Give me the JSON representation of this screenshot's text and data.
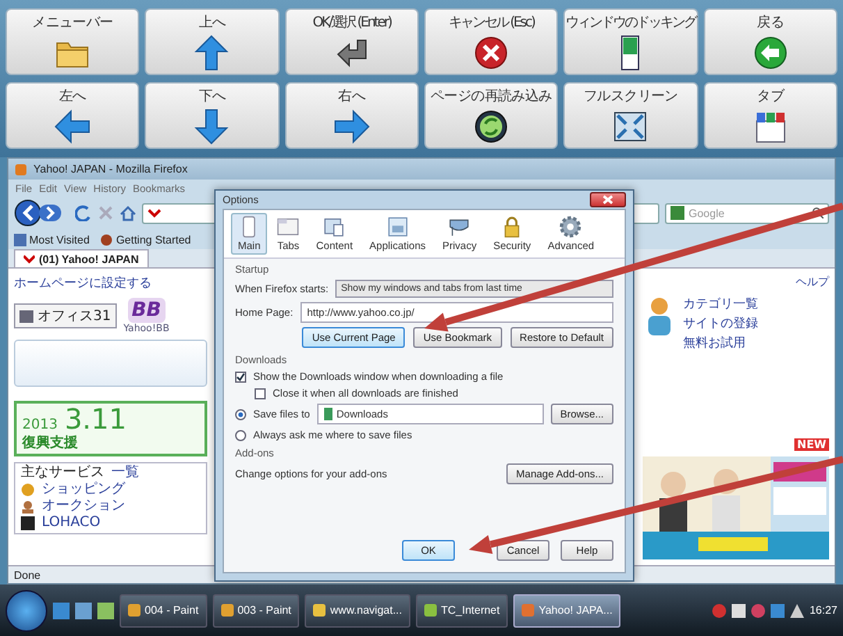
{
  "keypad": {
    "rows": [
      [
        {
          "label": "メニューバー"
        },
        {
          "label": "上へ"
        },
        {
          "label": "OK/選択 (Enter)"
        },
        {
          "label": "キャンセル (Esc)"
        },
        {
          "label": "ウィンドウのドッキング"
        },
        {
          "label": "戻る"
        }
      ],
      [
        {
          "label": "左へ"
        },
        {
          "label": "下へ"
        },
        {
          "label": "右へ"
        },
        {
          "label": "ページの再読み込み"
        },
        {
          "label": "フルスクリーン"
        },
        {
          "label": "タブ"
        }
      ]
    ]
  },
  "browser": {
    "title": "Yahoo! JAPAN - Mozilla Firefox",
    "menu": [
      "File",
      "Edit",
      "View",
      "History",
      "Bookmarks"
    ],
    "search_placeholder": "Google",
    "bookmarks": [
      "Most Visited",
      "Getting Started"
    ],
    "tab": "(01) Yahoo! JAPAN",
    "page": {
      "set_home": "ホームページに設定する",
      "office": "オフィス31",
      "bb_logo": "BB",
      "bb_label": "Yahoo!BB",
      "banner": {
        "year": "2013",
        "date": "3.11",
        "caption": "復興支援"
      },
      "services_title": "主なサービス",
      "services_all": "一覧",
      "services": [
        "ショッピング",
        "オークション",
        "LOHACO"
      ],
      "help": "ヘルプ",
      "right_links": [
        "カテゴリ一覧",
        "サイトの登録",
        "無料お試用"
      ],
      "new_badge": "NEW"
    },
    "status": "Done"
  },
  "dialog": {
    "title": "Options",
    "tabs": [
      {
        "label": "Main",
        "selected": true
      },
      {
        "label": "Tabs",
        "selected": false
      },
      {
        "label": "Content",
        "selected": false
      },
      {
        "label": "Applications",
        "selected": false
      },
      {
        "label": "Privacy",
        "selected": false
      },
      {
        "label": "Security",
        "selected": false
      },
      {
        "label": "Advanced",
        "selected": false
      }
    ],
    "startup": {
      "heading": "Startup",
      "when_label": "When Firefox starts:",
      "when_value": "Show my windows and tabs from last time",
      "home_label": "Home Page:",
      "home_value": "http://www.yahoo.co.jp/",
      "buttons": [
        {
          "label": "Use Current Page",
          "focused": true
        },
        {
          "label": "Use Bookmark",
          "focused": false
        },
        {
          "label": "Restore to Default",
          "focused": false
        }
      ]
    },
    "downloads": {
      "heading": "Downloads",
      "checkboxes": [
        {
          "label": "Show the Downloads window when downloading a file",
          "checked": true,
          "children": [
            {
              "label": "Close it when all downloads are finished",
              "checked": false
            }
          ]
        }
      ],
      "save_choices": [
        {
          "label": "Save files to",
          "selected": true,
          "folder": "Downloads",
          "button": "Browse..."
        },
        {
          "label": "Always ask me where to save files",
          "selected": false
        }
      ]
    },
    "addons": {
      "heading": "Add-ons",
      "text": "Change options for your add-ons",
      "button": "Manage Add-ons..."
    },
    "footer": [
      {
        "label": "OK",
        "focused": true
      },
      {
        "label": "Cancel",
        "focused": false
      },
      {
        "label": "Help",
        "focused": false
      }
    ]
  },
  "taskbar": {
    "tasks": [
      {
        "label": "004 - Paint",
        "selected": false
      },
      {
        "label": "003 - Paint",
        "selected": false
      },
      {
        "label": "www.navigat...",
        "selected": false
      },
      {
        "label": "TC_Internet",
        "selected": false
      },
      {
        "label": "Yahoo! JAPA...",
        "selected": true
      }
    ],
    "clock": "16:27"
  }
}
